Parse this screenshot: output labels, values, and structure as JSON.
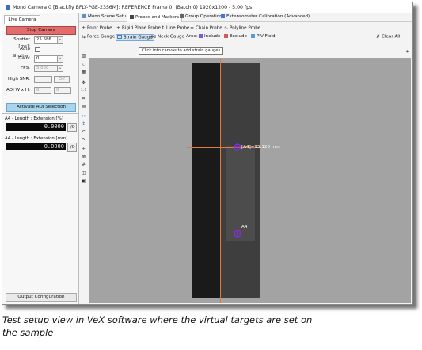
{
  "window": {
    "title": "Mono Camera 0 [Blackfly BFLY-PGE-23S6M]: REFERENCE Frame 0, (Batch 0) 1920x1200 - 5.00 fps"
  },
  "left_panel": {
    "tab": "Live Camera",
    "stop_button": "Stop Camera",
    "shutter_label": "Shutter [ms]:",
    "shutter_value": "25.586",
    "auto_shutter_label": "Auto Shutter:",
    "gain_label": "Gain:",
    "gain_value": "0",
    "fps_label": "FPS:",
    "fps_value": "5.000",
    "high_snr_label": "High SNR:",
    "high_snr_value": "Off",
    "aoi_label": "AOI W x H:",
    "aoi_w": "0",
    "aoi_h": "0",
    "aoi_button": "Activate AOI Selection",
    "measurements": [
      {
        "label": "A4 - Length : Extension [%]",
        "value": "0.0000",
        "io": "I/O"
      },
      {
        "label": "A4 - Length : Extension [mm]",
        "value": "0.0000",
        "io": "I/O"
      }
    ],
    "output_config": "Output Configuration"
  },
  "toolbar_tabs": [
    {
      "label": "Mono Scene Setup",
      "icon": "camera-icon"
    },
    {
      "label": "Probes and Markers",
      "icon": "probe-icon"
    },
    {
      "label": "Group Operations",
      "icon": "group-icon"
    },
    {
      "label": "Extensometer Calibration (Advanced)",
      "icon": "calibration-icon"
    }
  ],
  "probes_row": [
    "Point Probe",
    "Rigid Plane Probe",
    "Line Probe",
    "Chain Probe",
    "Polyline Probe"
  ],
  "gauges_row": [
    "Force Gauge",
    "Strain Gauge",
    "Neck Gauge"
  ],
  "area_label": "Area:",
  "area_row": [
    "Include",
    "Exclude",
    "PIV Field"
  ],
  "clear_all": "Clear All",
  "tooltip": "Click into canvas to add strain gauges",
  "overlay": {
    "top_tag": "[A4]=95.128 mm",
    "bottom_tag": "A4",
    "guide_color": "#e07b3e",
    "marker_color": "#8a2be2",
    "line_color": "#3ccf3c"
  },
  "caption": {
    "line1": "Test setup view in VeX software where the virtual targets are set on",
    "line2": "the sample"
  }
}
